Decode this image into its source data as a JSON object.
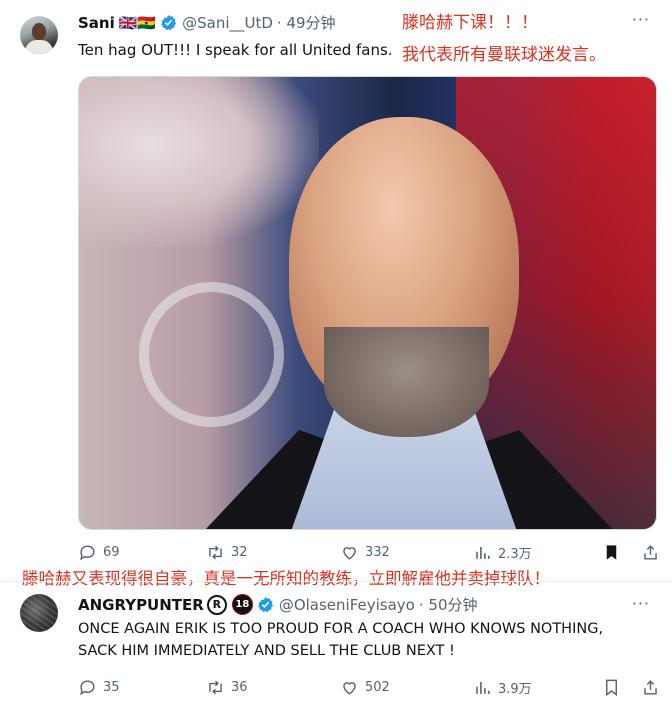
{
  "tweet1": {
    "author_name": "Sani",
    "flags": "🇬🇧🇬🇭",
    "handle": "@Sani__UtD",
    "time": "· 49分钟",
    "text": "Ten hag OUT!!! I speak for all United fans.",
    "annotation_line1": "滕哈赫下课！！！",
    "annotation_line2": "我代表所有曼联球迷发言。",
    "stats": {
      "replies": "69",
      "retweets": "32",
      "likes": "332",
      "views": "2.3万"
    }
  },
  "annotation_middle": "滕哈赫又表现得很自豪，真是一无所知的教练，立即解雇他并卖掉球队！",
  "tweet2": {
    "author_name": "ANGRYPUNTER",
    "badge_r": "R",
    "badge_18": "18",
    "handle": "@OlaseniFeyisayo",
    "time": "· 50分钟",
    "text_line1": "ONCE AGAIN ERIK IS TOO PROUD FOR A COACH WHO KNOWS NOTHING,",
    "text_line2": "SACK HIM IMMEDIATELY AND SELL THE CLUB NEXT !",
    "stats": {
      "replies": "35",
      "retweets": "36",
      "likes": "502",
      "views": "3.9万"
    }
  },
  "colors": {
    "verified": "#1d9bf0",
    "annotation": "#e0301e",
    "muted": "#536471"
  },
  "icons": [
    "verified-badge-icon",
    "more-icon",
    "reply-icon",
    "retweet-icon",
    "like-icon",
    "views-icon",
    "bookmark-icon",
    "share-icon"
  ]
}
